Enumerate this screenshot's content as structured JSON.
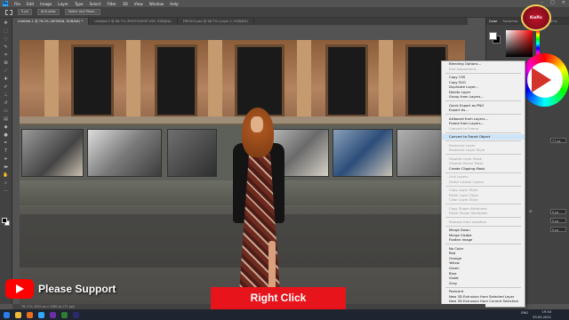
{
  "menubar": {
    "logo": "Ps",
    "items": [
      "File",
      "Edit",
      "Image",
      "Layer",
      "Type",
      "Select",
      "Filter",
      "3D",
      "View",
      "Window",
      "Help"
    ],
    "window_controls": [
      "–",
      "□",
      "✕"
    ]
  },
  "options": {
    "feather": "0 px",
    "anti_alias": "Anti-alias",
    "select_mask": "Select and Mask..."
  },
  "tabs": [
    {
      "label": "Untitled-1 @ 76.2% (WOMAN, RGB/8#) *",
      "active": true
    },
    {
      "label": "Untitled-2 @ 66.7% (PHOTOSHOP USE, RGB/8#)",
      "active": false
    },
    {
      "label": "FRESCO.psd @ 66.7% (Layer 1, RGB/8#)",
      "active": false
    }
  ],
  "context_menu": {
    "items": [
      {
        "label": "Blending Options...",
        "disabled": false
      },
      {
        "label": "Edit Adjustment...",
        "disabled": true
      },
      {
        "sep": true
      },
      {
        "label": "Copy CSS",
        "disabled": false
      },
      {
        "label": "Copy SVG",
        "disabled": false
      },
      {
        "label": "Duplicate Layer...",
        "disabled": false
      },
      {
        "label": "Delete Layer",
        "disabled": false
      },
      {
        "label": "Group from Layers...",
        "disabled": false
      },
      {
        "sep": true
      },
      {
        "label": "Quick Export as PNG",
        "disabled": false
      },
      {
        "label": "Export As...",
        "disabled": false
      },
      {
        "sep": true
      },
      {
        "label": "Artboard from Layers...",
        "disabled": false
      },
      {
        "label": "Frame from Layers...",
        "disabled": false
      },
      {
        "label": "Convert to Frame",
        "disabled": true
      },
      {
        "sep": true
      },
      {
        "label": "Convert to Smart Object",
        "disabled": false,
        "highlight": true
      },
      {
        "sep": true
      },
      {
        "label": "Rasterize Layer",
        "disabled": true
      },
      {
        "label": "Rasterize Layer Style",
        "disabled": true
      },
      {
        "sep": true
      },
      {
        "label": "Disable Layer Mask",
        "disabled": true
      },
      {
        "label": "Disable Vector Mask",
        "disabled": true
      },
      {
        "label": "Create Clipping Mask",
        "disabled": false
      },
      {
        "sep": true
      },
      {
        "label": "Link Layers",
        "disabled": true
      },
      {
        "label": "Select Linked Layers",
        "disabled": true
      },
      {
        "sep": true
      },
      {
        "label": "Copy Layer Style",
        "disabled": true
      },
      {
        "label": "Paste Layer Style",
        "disabled": true
      },
      {
        "label": "Clear Layer Style",
        "disabled": true
      },
      {
        "sep": true
      },
      {
        "label": "Copy Shape Attributes",
        "disabled": true
      },
      {
        "label": "Paste Shape Attributes",
        "disabled": true
      },
      {
        "sep": true
      },
      {
        "label": "Release from Isolation",
        "disabled": true
      },
      {
        "sep": true
      },
      {
        "label": "Merge Down",
        "disabled": false
      },
      {
        "label": "Merge Visible",
        "disabled": false
      },
      {
        "label": "Flatten Image",
        "disabled": false
      },
      {
        "sep": true
      },
      {
        "label": "No Color",
        "disabled": false
      },
      {
        "label": "Red",
        "disabled": false
      },
      {
        "label": "Orange",
        "disabled": false
      },
      {
        "label": "Yellow",
        "disabled": false
      },
      {
        "label": "Green",
        "disabled": false
      },
      {
        "label": "Blue",
        "disabled": false
      },
      {
        "label": "Violet",
        "disabled": false
      },
      {
        "label": "Gray",
        "disabled": false
      },
      {
        "sep": true
      },
      {
        "label": "Postcard",
        "disabled": false
      },
      {
        "label": "New 3D Extrusion from Selected Layer",
        "disabled": false
      },
      {
        "label": "New 3D Extrusion from Current Selection",
        "disabled": false
      }
    ]
  },
  "panels": {
    "tabs": [
      "Color",
      "Swatches",
      "Gradients",
      "Patterns"
    ],
    "props_width": "W",
    "props_values": [
      "77 px",
      "0 px",
      "0 px",
      "0 px"
    ]
  },
  "overlays": {
    "channel_name": "KinPic",
    "support_text": "Please Support",
    "right_click": "Right Click"
  },
  "status": {
    "zoom_doc": "76.17%   1920 px x 1080 px (72 ppi)"
  },
  "taskbar": {
    "lang": "ENG",
    "time": "19:34",
    "date": "29-05-2021"
  },
  "colors": {
    "accent": "#e8141b",
    "youtube": "#ff0000"
  }
}
